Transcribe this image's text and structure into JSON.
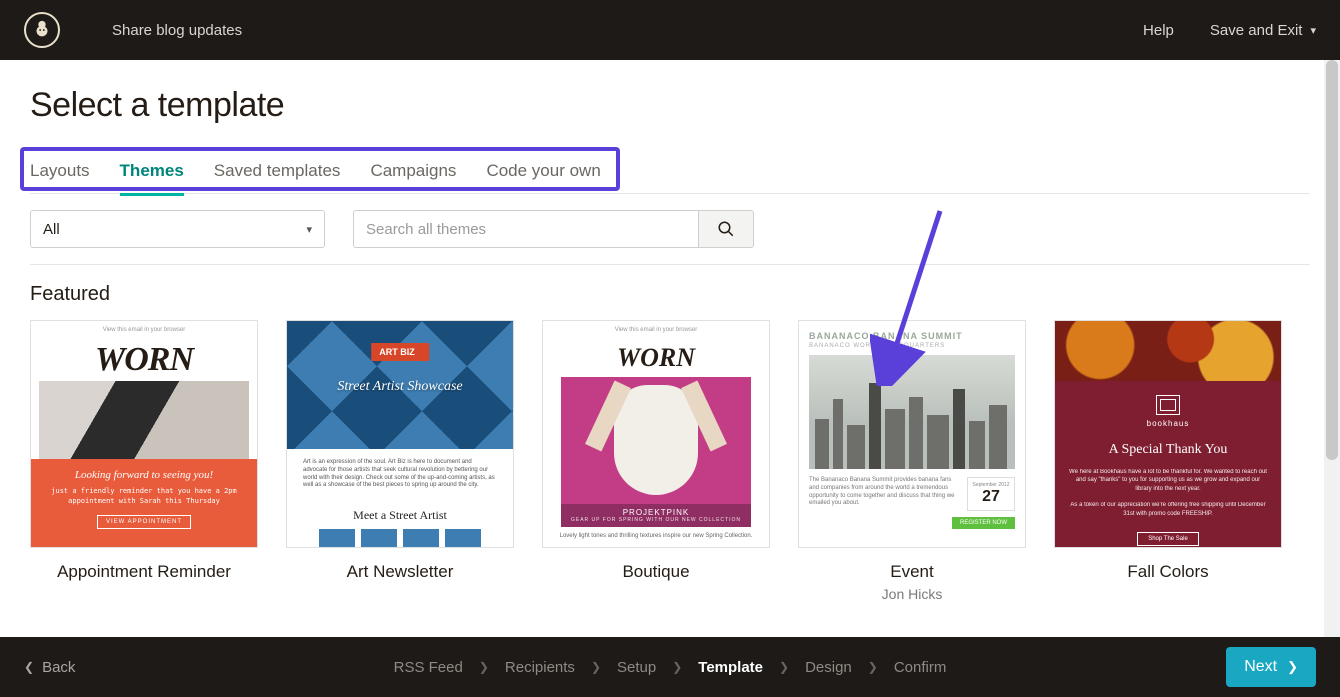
{
  "header": {
    "campaign_name": "Share blog updates",
    "help": "Help",
    "save_exit": "Save and Exit"
  },
  "page": {
    "title": "Select a template",
    "tabs": [
      "Layouts",
      "Themes",
      "Saved templates",
      "Campaigns",
      "Code your own"
    ],
    "active_tab_index": 1,
    "filter_value": "All",
    "search_placeholder": "Search all themes",
    "section_heading": "Featured"
  },
  "templates": [
    {
      "name": "Appointment Reminder",
      "author": "",
      "preview": {
        "tiny": "View this email in your browser",
        "logo": "WORN",
        "headline": "Looking forward to seeing you!",
        "sub": "just a friendly reminder that you have a 2pm appointment with Sarah this Thursday",
        "cta": "VIEW APPOINTMENT"
      }
    },
    {
      "name": "Art Newsletter",
      "author": "",
      "preview": {
        "badge": "ART BIZ",
        "title": "Street Artist Showcase",
        "body": "Art is an expression of the soul. Art Biz is here to document and advocate for those artists that seek cultural revolution by bettering our world with their design. Check out some of the up-and-coming artists, as well as a showcase of the best pieces to spring up around the city.",
        "subhead": "Meet a Street Artist"
      }
    },
    {
      "name": "Boutique",
      "author": "",
      "preview": {
        "tiny": "View this email in your browser",
        "logo": "WORN",
        "label": "PROJEKTPINK",
        "strap": "GEAR UP FOR SPRING WITH OUR NEW COLLECTION",
        "caption": "Lovely light tones and thrilling textures inspire our new Spring Collection."
      }
    },
    {
      "name": "Event",
      "author": "Jon Hicks",
      "preview": {
        "t1": "BANANACO BANANA SUMMIT",
        "t2": "BANANACO WORLD HEADQUARTERS",
        "body": "The Bananaco Banana Summit provides banana fans and companies from around the world a tremendous opportunity to come together and discuss that thing we emailed you about.",
        "month": "September 2012",
        "day": "27",
        "cta": "REGISTER NOW"
      }
    },
    {
      "name": "Fall Colors",
      "author": "",
      "preview": {
        "brand": "bookhaus",
        "headline": "A Special Thank You",
        "p1": "We here at Bookhaus have a lot to be thankful for. We wanted to reach out and say \"thanks\" to you for supporting us as we grow and expand our library into the next year.",
        "p2": "As a token of our appreciation we're offering free shipping until December 31st with promo code FREESHIP.",
        "cta": "Shop The Sale"
      }
    }
  ],
  "footer": {
    "back": "Back",
    "crumbs": [
      "RSS Feed",
      "Recipients",
      "Setup",
      "Template",
      "Design",
      "Confirm"
    ],
    "active_crumb_index": 3,
    "next": "Next"
  }
}
